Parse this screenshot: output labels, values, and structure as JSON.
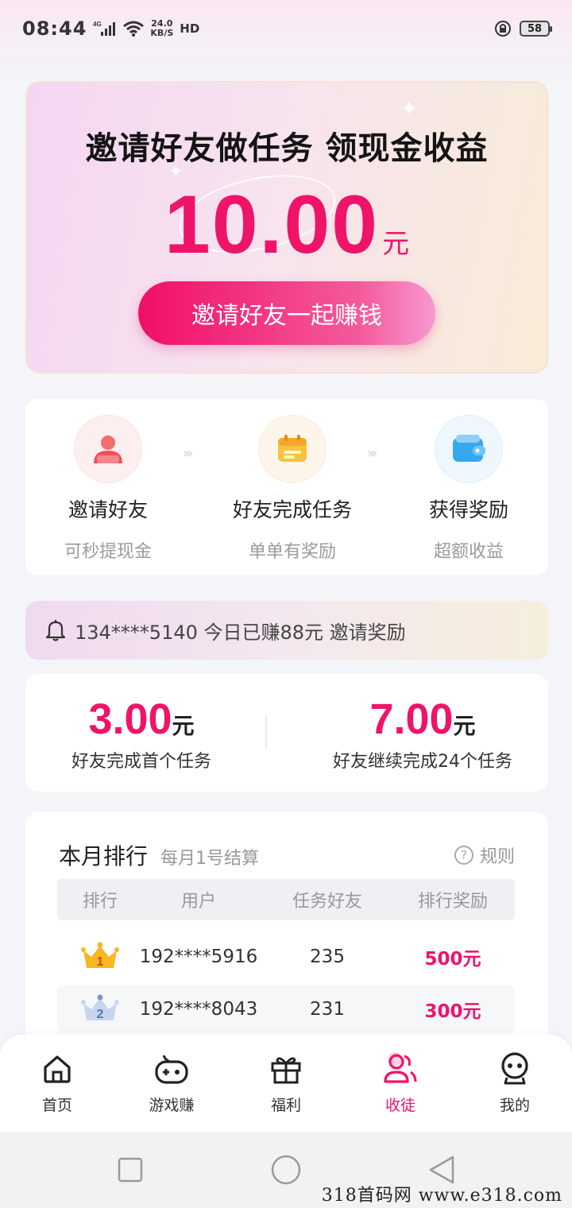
{
  "status_bar": {
    "time": "08:44",
    "network": "4G",
    "speed_value": "24.0",
    "speed_unit": "KB/S",
    "hd": "HD",
    "battery": "58"
  },
  "hero": {
    "title": "邀请好友做任务 领现金收益",
    "amount": "10.00",
    "unit": "元",
    "button": "邀请好友一起赚钱"
  },
  "steps": [
    {
      "label": "邀请好友",
      "sub": "可秒提现金",
      "icon": "person-icon"
    },
    {
      "label": "好友完成任务",
      "sub": "单单有奖励",
      "icon": "calendar-icon"
    },
    {
      "label": "获得奖励",
      "sub": "超额收益",
      "icon": "wallet-icon"
    }
  ],
  "notice": {
    "text": "134****5140 今日已赚88元 邀请奖励"
  },
  "rewards": [
    {
      "amount": "3.00",
      "unit": "元",
      "desc": "好友完成首个任务"
    },
    {
      "amount": "7.00",
      "unit": "元",
      "desc": "好友继续完成24个任务"
    }
  ],
  "ranking": {
    "title": "本月排行",
    "subtitle": "每月1号结算",
    "rules": "规则",
    "columns": [
      "排行",
      "用户",
      "任务好友",
      "排行奖励"
    ],
    "rows": [
      {
        "rank": "1",
        "user": "192****5916",
        "friends": "235",
        "reward": "500元"
      },
      {
        "rank": "2",
        "user": "192****8043",
        "friends": "231",
        "reward": "300元"
      }
    ]
  },
  "nav": {
    "items": [
      {
        "label": "首页",
        "icon": "home-icon"
      },
      {
        "label": "游戏赚",
        "icon": "gamepad-icon"
      },
      {
        "label": "福利",
        "icon": "gift-icon"
      },
      {
        "label": "收徒",
        "icon": "users-icon",
        "active": true
      },
      {
        "label": "我的",
        "icon": "profile-icon"
      }
    ]
  },
  "watermark": "318首码网  www.e318.com",
  "colors": {
    "accent": "#f0136a",
    "background": "#f4f5f9"
  }
}
